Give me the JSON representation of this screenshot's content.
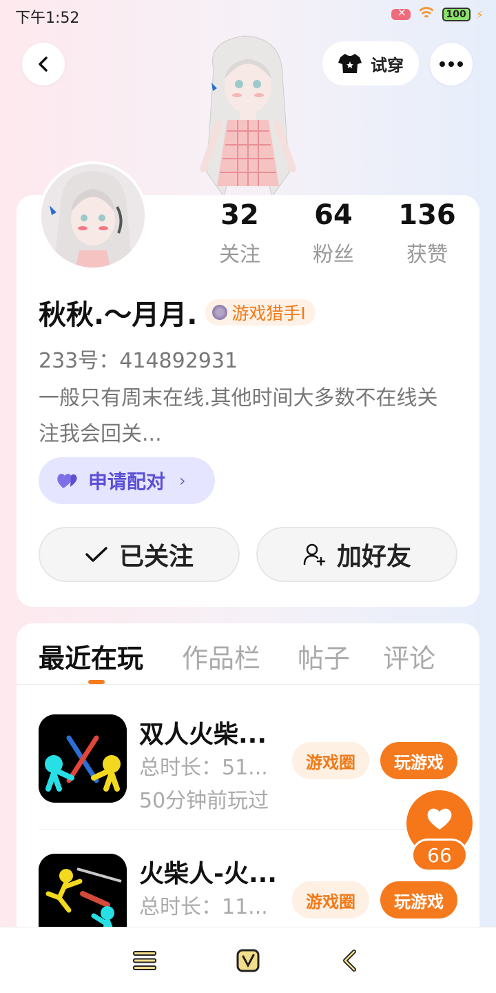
{
  "status_bar": {
    "time": "下午1:52",
    "battery": "100"
  },
  "header": {
    "tryon_label": "试穿"
  },
  "profile": {
    "stats": [
      {
        "value": "32",
        "label": "关注"
      },
      {
        "value": "64",
        "label": "粉丝"
      },
      {
        "value": "136",
        "label": "获赞"
      }
    ],
    "name": "秋秋.～月月.",
    "badge": "游戏猎手I",
    "uid": "233号：414892931",
    "bio": "一般只有周末在线.其他时间大多数不在线关注我会回关...",
    "pair_label": "申请配对",
    "followed_label": "已关注",
    "add_friend_label": "加好友"
  },
  "tabs": [
    "最近在玩",
    "作品栏",
    "帖子",
    "评论"
  ],
  "games": [
    {
      "title": "双人火柴...",
      "duration": "总时长：51...",
      "last_played": "50分钟前玩过",
      "circle_label": "游戏圈",
      "play_label": "玩游戏"
    },
    {
      "title": "火柴人-火...",
      "duration": "总时长：11...",
      "last_played": "",
      "circle_label": "游戏圈",
      "play_label": "玩游戏"
    }
  ],
  "likes": {
    "count": "66"
  },
  "colors": {
    "accent": "#f57a1e",
    "pair_bg": "#e6e5ff",
    "pair_text": "#5b4fd6"
  },
  "icons": [
    "back-icon",
    "tshirt-icon",
    "more-icon",
    "heart-icon",
    "check-icon",
    "add-user-icon",
    "menu-icon",
    "home-icon",
    "nav-back-icon"
  ]
}
